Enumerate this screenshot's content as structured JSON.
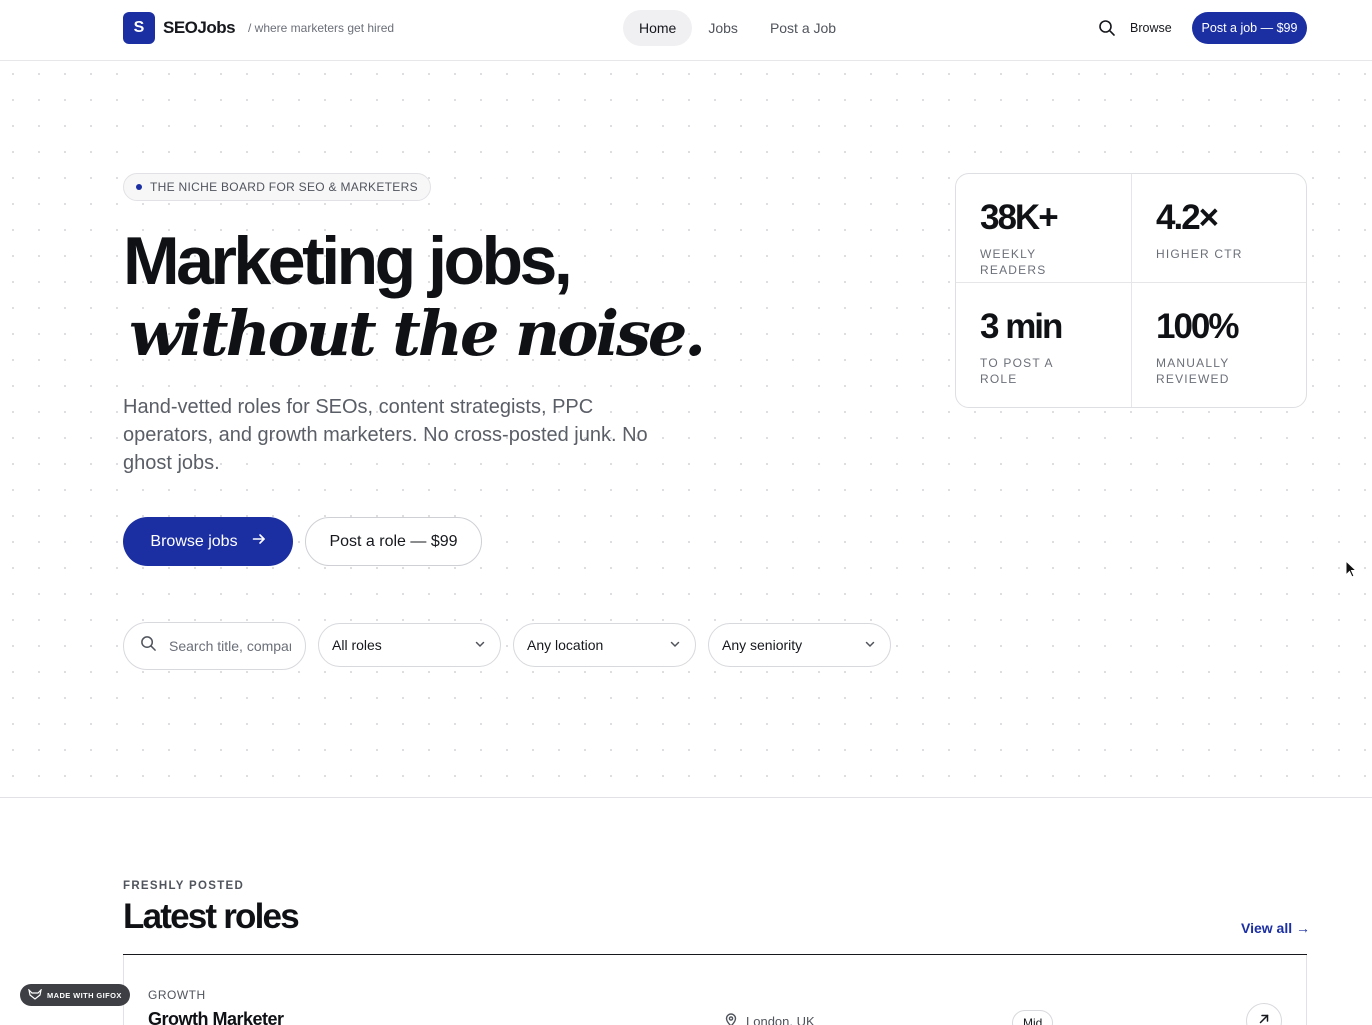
{
  "header": {
    "logo_letter": "S",
    "brand": "SEOJobs",
    "tagline": "/ where marketers get hired",
    "nav": [
      {
        "label": "Home",
        "active": true
      },
      {
        "label": "Jobs",
        "active": false
      },
      {
        "label": "Post a Job",
        "active": false
      }
    ],
    "search_icon": "search-icon",
    "browse_label": "Browse",
    "post_button_label": "Post a job — $99"
  },
  "hero": {
    "pill": "THE NICHE BOARD FOR SEO & MARKETERS",
    "headline_line1": "Marketing jobs,",
    "headline_line2": "without the noise.",
    "subtitle": "Hand-vetted roles for SEOs, content strategists, PPC operators, and growth marketers. No cross-posted junk. No ghost jobs.",
    "browse_button": "Browse jobs",
    "post_button": "Post a role — $99",
    "search_placeholder": "Search title, company",
    "filters": [
      {
        "selected": "All roles"
      },
      {
        "selected": "Any location"
      },
      {
        "selected": "Any seniority"
      }
    ]
  },
  "stats": [
    {
      "value": "38K+",
      "label": "WEEKLY READERS"
    },
    {
      "value": "4.2×",
      "label": "HIGHER CTR"
    },
    {
      "value": "3 min",
      "label": "TO POST A ROLE"
    },
    {
      "value": "100%",
      "label": "MANUALLY REVIEWED"
    }
  ],
  "latest": {
    "eyebrow": "FRESHLY POSTED",
    "title": "Latest roles",
    "view_all": "View all →",
    "jobs": [
      {
        "category": "GROWTH",
        "title": "Growth Marketer",
        "location": "London, UK",
        "level": "Mid"
      }
    ]
  },
  "badge": {
    "label": "MADE WITH GIFOX"
  },
  "colors": {
    "accent": "#1b2fa3",
    "text": "#16181d",
    "muted": "#6b6f78",
    "border": "#e2e2e6"
  }
}
